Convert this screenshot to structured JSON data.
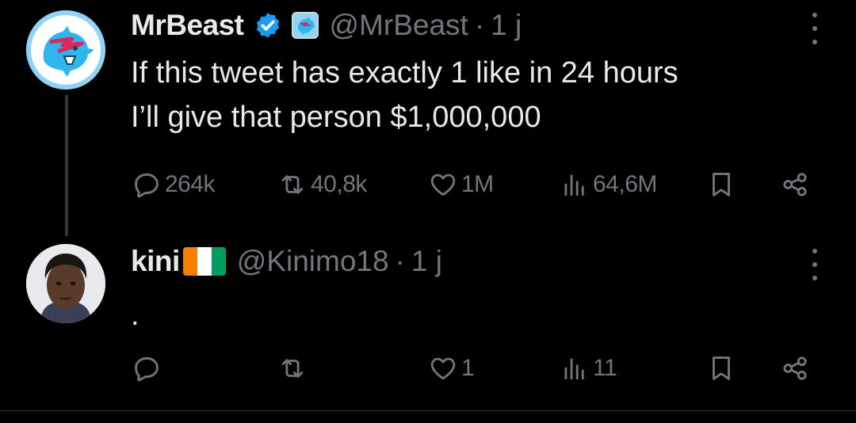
{
  "tweets": [
    {
      "name": "MrBeast",
      "handle": "@MrBeast",
      "separator": "·",
      "time": "1 j",
      "text_lines": [
        "If this tweet has exactly 1 like in 24 hours",
        "I’ll give that person $1,000,000"
      ],
      "verified": true,
      "avatar": "mrbeast-logo-avatar",
      "actions": {
        "reply_count": "264k",
        "retweet_count": "40,8k",
        "like_count": "1M",
        "views_count": "64,6M"
      }
    },
    {
      "name": "kini",
      "flag": "Côte d'Ivoire flag",
      "handle": "@Kinimo18",
      "separator": "·",
      "time": "1 j",
      "text_lines": [
        "."
      ],
      "verified": false,
      "avatar": "user-photo-avatar",
      "actions": {
        "reply_count": "",
        "retweet_count": "",
        "like_count": "1",
        "views_count": "11"
      }
    }
  ],
  "colors": {
    "background": "#000000",
    "primary_text": "#e7e9ea",
    "secondary_text": "#71767b",
    "verified_blue": "#1d9bf0",
    "flag_orange": "#f77f00",
    "flag_white": "#ffffff",
    "flag_green": "#009e60"
  }
}
